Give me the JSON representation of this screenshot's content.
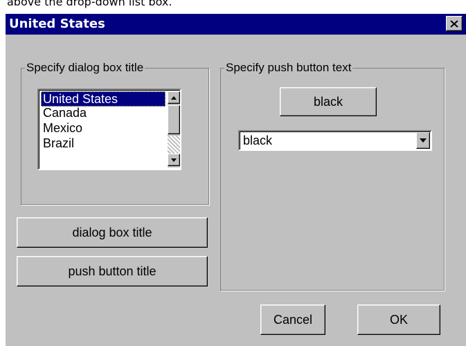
{
  "caption": "above the drop-down list box.",
  "window": {
    "title": "United States",
    "close_icon": "close-x-icon"
  },
  "dialog_title_group": {
    "label": "Specify dialog box title",
    "list_items": [
      {
        "label": "United States",
        "selected": true
      },
      {
        "label": "Canada",
        "selected": false
      },
      {
        "label": "Mexico",
        "selected": false
      },
      {
        "label": "Brazil",
        "selected": false
      }
    ]
  },
  "push_button_group": {
    "label": "Specify push button text",
    "sample_button_label": "black",
    "combo_value": "black"
  },
  "buttons": {
    "dialog_box_title": "dialog box title",
    "push_button_title": "push button title",
    "cancel": "Cancel",
    "ok": "OK"
  },
  "colors": {
    "title_bar": "#000080",
    "face": "#c0c0c0",
    "selection": "#000080"
  }
}
